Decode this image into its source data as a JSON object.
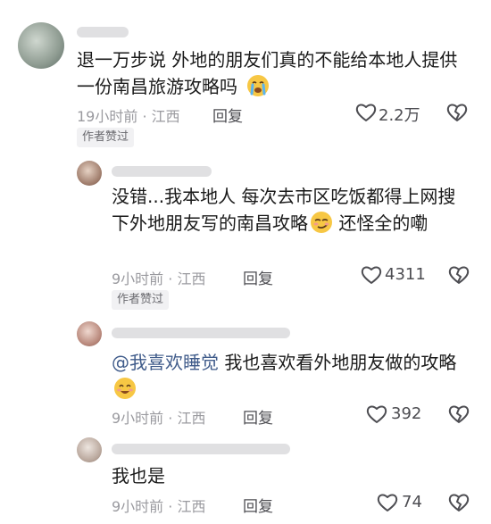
{
  "comment1": {
    "text": "退一万步说 外地的朋友们真的不能给本地人提供一份南昌旅游攻略吗",
    "time": "19小时前",
    "location": "江西",
    "reply_label": "回复",
    "likes": "2.2万",
    "badge": "作者赞过"
  },
  "reply1": {
    "text_a": "没错...我本地人 每次去市区吃饭都得上网搜下外地朋友写的南昌攻略",
    "text_b": " 还怪全的嘞",
    "time": "9小时前",
    "location": "江西",
    "reply_label": "回复",
    "likes": "4311",
    "badge": "作者赞过"
  },
  "reply2": {
    "mention": "@我喜欢睡觉",
    "text": " 我也喜欢看外地朋友做的攻略",
    "time": "9小时前",
    "location": "江西",
    "reply_label": "回复",
    "likes": "392"
  },
  "reply3": {
    "text": "我也是",
    "time": "9小时前",
    "location": "江西",
    "reply_label": "回复",
    "likes": "74"
  },
  "icons": [
    "heart-icon",
    "dislike-heart-icon",
    "crying-emoji",
    "smug-emoji",
    "smile-emoji"
  ],
  "colors": {
    "mention": "#3f5b8a",
    "meta": "#9a9a9f",
    "badge_bg": "#f1f1f3"
  }
}
